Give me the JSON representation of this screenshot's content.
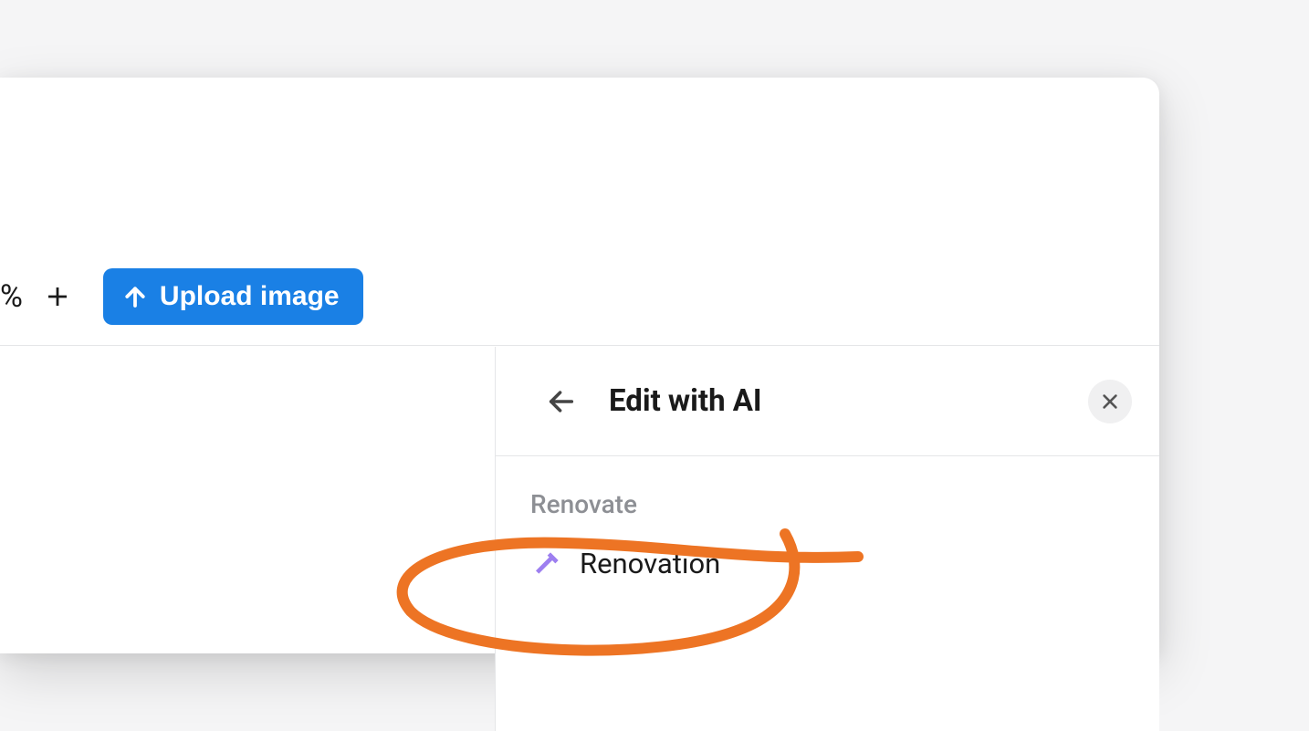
{
  "toolbar": {
    "percent_fragment": "%",
    "upload_label": "Upload image"
  },
  "panel": {
    "title": "Edit with AI",
    "section_label": "Renovate",
    "items": [
      {
        "icon": "hammer-icon",
        "label": "Renovation"
      }
    ]
  },
  "colors": {
    "primary_button": "#1a80e5",
    "icon_accent": "#9d7ff0",
    "annotation": "#ed7424"
  }
}
